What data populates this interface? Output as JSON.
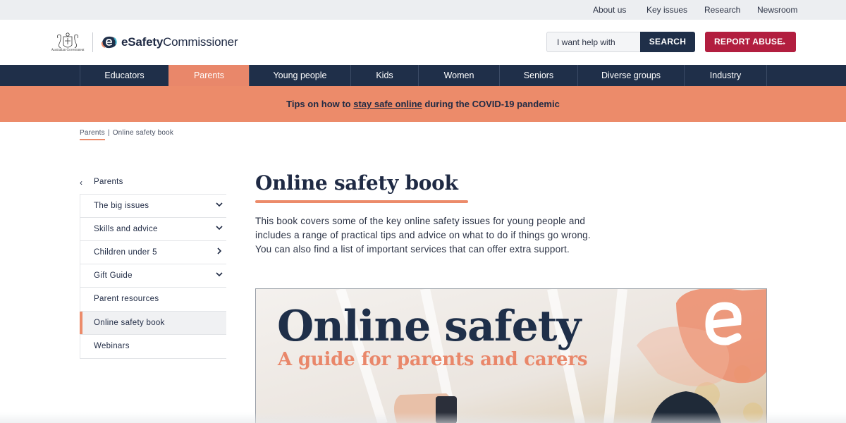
{
  "utility_nav": [
    "About us",
    "Key issues",
    "Research",
    "Newsroom"
  ],
  "header": {
    "gov_label": "Australian Government",
    "logo_prefix": "eSafety",
    "logo_suffix": "Commissioner",
    "search_placeholder": "I want help with",
    "search_button": "SEARCH",
    "report_button": "REPORT ABUSE"
  },
  "main_nav": [
    {
      "label": "Educators",
      "active": false
    },
    {
      "label": "Parents",
      "active": true
    },
    {
      "label": "Young people",
      "active": false
    },
    {
      "label": "Kids",
      "active": false
    },
    {
      "label": "Women",
      "active": false
    },
    {
      "label": "Seniors",
      "active": false
    },
    {
      "label": "Diverse groups",
      "active": false
    },
    {
      "label": "Industry",
      "active": false
    }
  ],
  "banner": {
    "prefix": "Tips on how to ",
    "link": "stay safe online",
    "suffix": " during the COVID-19 pandemic"
  },
  "breadcrumb": {
    "parent": "Parents",
    "separator": "|",
    "current": "Online safety book"
  },
  "side_menu": {
    "back_label": "Parents",
    "items": [
      {
        "label": "The big issues",
        "indicator": "chevron-down-icon"
      },
      {
        "label": "Skills and advice",
        "indicator": "chevron-down-icon"
      },
      {
        "label": "Children under 5",
        "indicator": "chevron-right-icon"
      },
      {
        "label": "Gift Guide",
        "indicator": "chevron-down-icon"
      },
      {
        "label": "Parent resources",
        "indicator": ""
      },
      {
        "label": "Online safety book",
        "indicator": "",
        "active": true
      },
      {
        "label": "Webinars",
        "indicator": ""
      }
    ]
  },
  "content": {
    "title": "Online safety book",
    "intro": "This book covers some of the key online safety issues for young people and includes a range of practical tips and advice on what to do if things go wrong. You can also find a list of important services that can offer extra support."
  },
  "cover": {
    "title": "Online safety",
    "subtitle": "A guide for parents and carers"
  },
  "colors": {
    "navy": "#1f2f49",
    "accent": "#ec8b6a",
    "report": "#b21e3f"
  }
}
